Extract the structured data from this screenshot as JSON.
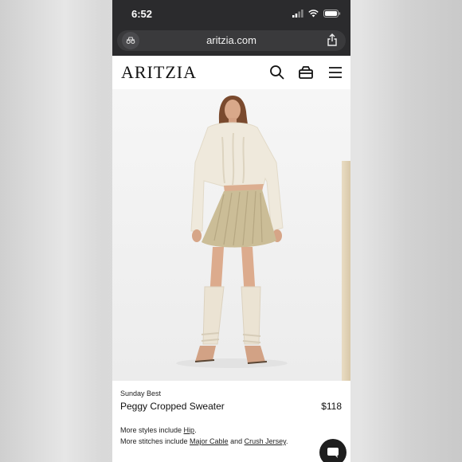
{
  "status": {
    "time": "6:52"
  },
  "browser": {
    "url": "aritzia.com"
  },
  "header": {
    "logo": "ARITZIA"
  },
  "product": {
    "brand": "Sunday Best",
    "name": "Peggy Cropped Sweater",
    "price": "$118",
    "styles_prefix": "More styles include ",
    "styles_link": "Hip",
    "styles_suffix": ".",
    "stitches_prefix": "More stitches include ",
    "stitches_link_1": "Major Cable",
    "stitches_join": " and ",
    "stitches_link_2": "Crush Jersey",
    "stitches_suffix": "."
  },
  "icons": [
    "reader-mode-icon",
    "share-icon",
    "search-icon",
    "bag-icon",
    "menu-icon",
    "chat-icon"
  ]
}
